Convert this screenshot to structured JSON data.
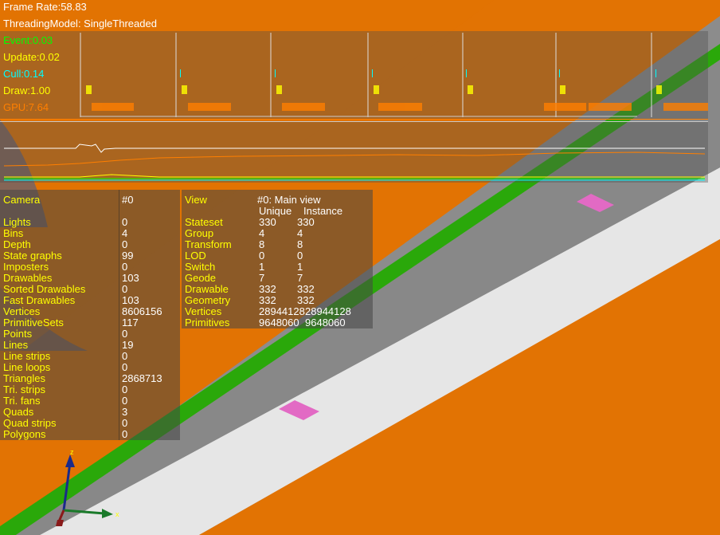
{
  "hud": {
    "frame_rate": "Frame Rate:58.83",
    "threading_model": "ThreadingModel: SingleThreaded"
  },
  "timing": {
    "event": "Event:0.03",
    "update": "Update:0.02",
    "cull": "Cull:0.14",
    "draw": "Draw:1.00",
    "gpu": "GPU:7.64"
  },
  "colors": {
    "background": "#e27303",
    "event": "#00ff00",
    "update": "#ffff00",
    "cull": "#00ffff",
    "draw": "#ffff00",
    "gpu": "#ff7f00",
    "road": "#e6e6e6",
    "stripe": "#2aa80a",
    "marker": "#e26ac4"
  },
  "camera_stats": {
    "header_label": "Camera",
    "header_value": "#0",
    "rows": [
      {
        "label": "Lights",
        "value": "0"
      },
      {
        "label": "Bins",
        "value": "4"
      },
      {
        "label": "Depth",
        "value": "0"
      },
      {
        "label": "State graphs",
        "value": "99"
      },
      {
        "label": "Imposters",
        "value": "0"
      },
      {
        "label": "Drawables",
        "value": "103"
      },
      {
        "label": "Sorted Drawables",
        "value": "0"
      },
      {
        "label": "Fast Drawables",
        "value": "103"
      },
      {
        "label": "Vertices",
        "value": "8606156"
      },
      {
        "label": "PrimitiveSets",
        "value": "117"
      },
      {
        "label": "Points",
        "value": "0"
      },
      {
        "label": "Lines",
        "value": "19"
      },
      {
        "label": "Line strips",
        "value": "0"
      },
      {
        "label": "Line loops",
        "value": "0"
      },
      {
        "label": "Triangles",
        "value": "2868713"
      },
      {
        "label": "Tri. strips",
        "value": "0"
      },
      {
        "label": "Tri. fans",
        "value": "0"
      },
      {
        "label": "Quads",
        "value": "3"
      },
      {
        "label": "Quad strips",
        "value": "0"
      },
      {
        "label": "Polygons",
        "value": "0"
      }
    ]
  },
  "view_stats": {
    "header_label": "View",
    "header_value": "#0: Main view",
    "col_unique": "Unique",
    "col_instance": "Instance",
    "rows": [
      {
        "label": "Stateset",
        "unique": "330",
        "instance": "330"
      },
      {
        "label": "Group",
        "unique": "4",
        "instance": "4"
      },
      {
        "label": "Transform",
        "unique": "8",
        "instance": "8"
      },
      {
        "label": "LOD",
        "unique": "0",
        "instance": "0"
      },
      {
        "label": "Switch",
        "unique": "1",
        "instance": "1"
      },
      {
        "label": "Geode",
        "unique": "7",
        "instance": "7"
      },
      {
        "label": "Drawable",
        "unique": "332",
        "instance": "332"
      },
      {
        "label": "Geometry",
        "unique": "332",
        "instance": "332"
      },
      {
        "label": "Vertices",
        "unique": "28944128",
        "instance": "28944128"
      },
      {
        "label": "Primitives",
        "unique": "9648060",
        "instance": "9648060"
      }
    ]
  },
  "axes": {
    "z_label": "z",
    "x_label": "x"
  }
}
